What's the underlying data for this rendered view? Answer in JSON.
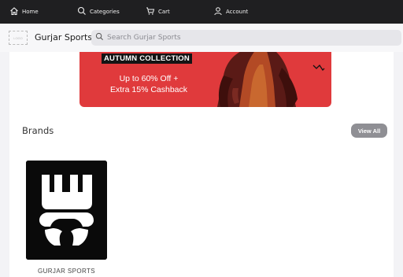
{
  "nav": {
    "home": "Home",
    "categories": "Categories",
    "cart": "Cart",
    "account": "Account"
  },
  "header": {
    "logo_text": "LOGO",
    "brand_name": "Gurjar Sports",
    "search_placeholder": "Search Gurjar Sports"
  },
  "banner": {
    "collection": "AUTUMN COLLECTION",
    "offer_line1": "Up to 60% Off +",
    "offer_line2": "Extra 15% Cashback",
    "color": "#e03a3c"
  },
  "brands": {
    "title": "Brands",
    "view_all": "View All",
    "items": [
      {
        "label": "GURJAR SPORTS"
      }
    ]
  }
}
